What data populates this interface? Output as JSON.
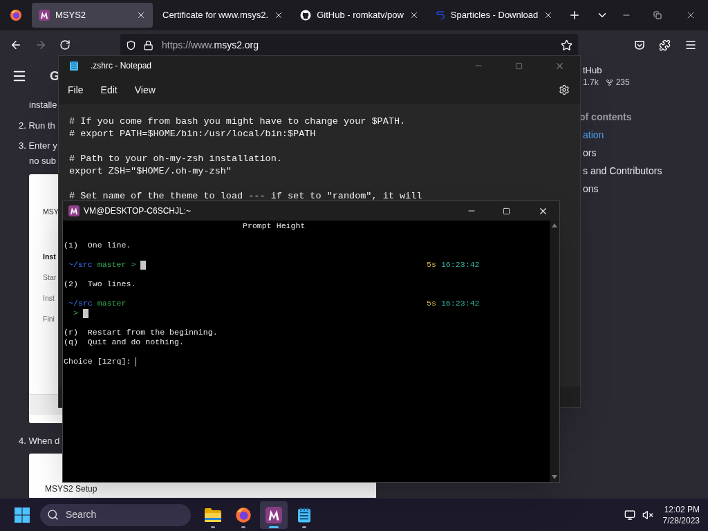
{
  "browser": {
    "tabs": [
      {
        "kind": "msys",
        "title": "MSYS2",
        "selected": true
      },
      {
        "kind": "plain",
        "title": "Certificate for www.msys2.",
        "selected": false
      },
      {
        "kind": "github",
        "title": "GitHub - romkatv/pow",
        "selected": false
      },
      {
        "kind": "sparticles",
        "title": "Sparticles - Download",
        "selected": false
      }
    ],
    "forward_disabled": true,
    "address": {
      "prefix": "https://www.",
      "domain": "msys2.org"
    }
  },
  "page": {
    "heading": "G",
    "left_lines": [
      {
        "kind": "continuation",
        "text": "installe"
      },
      {
        "kind": "step",
        "text": "2. Run th"
      },
      {
        "kind": "step",
        "text": "3. Enter y"
      },
      {
        "kind": "continuation",
        "text": "no sub"
      }
    ],
    "installer_card": {
      "title": "MSY",
      "section": "Inst",
      "steps": [
        "Star",
        "Inst",
        "Fini"
      ]
    },
    "after_card": {
      "kind": "step",
      "text": "4. When d"
    },
    "setup_card": {
      "title": "MSYS2 Setup"
    },
    "github": {
      "label": "tHub",
      "star_count": "1.7k",
      "fork_count": "235"
    },
    "toc": {
      "title": "of contents",
      "items": [
        {
          "text": "ation",
          "selected": true
        },
        {
          "text": "ors",
          "selected": false
        },
        {
          "text": "s and Contributors",
          "selected": false
        },
        {
          "text": "ons",
          "selected": false
        }
      ]
    }
  },
  "notepad": {
    "title": ".zshrc - Notepad",
    "menu": [
      "File",
      "Edit",
      "View"
    ],
    "paragraphs": [
      [
        "# If you come from bash you might have to change your $PATH.",
        "# export PATH=$HOME/bin:/usr/local/bin:$PATH"
      ],
      [
        "# Path to your oh-my-zsh installation.",
        "export ZSH=\"$HOME/.oh-my-zsh\""
      ],
      [
        "# Set name of the theme to load --- if set to \"random\", it will"
      ]
    ]
  },
  "terminal": {
    "title": "VM@DESKTOP-C6SCHJL:~",
    "lines": [
      {
        "kind": "heading",
        "text": "Prompt Height"
      },
      {
        "kind": "blank"
      },
      {
        "kind": "text",
        "text": "(1)  One line."
      },
      {
        "kind": "blank"
      },
      {
        "kind": "prompt_one_line",
        "dir": "~/src",
        "branch": "master",
        "symbol": ">",
        "duration": "5s",
        "time": "16:23:42"
      },
      {
        "kind": "blank"
      },
      {
        "kind": "text",
        "text": "(2)  Two lines."
      },
      {
        "kind": "blank"
      },
      {
        "kind": "prompt_two_line",
        "dir": "~/src",
        "branch": "master",
        "symbol": ">",
        "duration": "5s",
        "time": "16:23:42"
      },
      {
        "kind": "blank"
      },
      {
        "kind": "text",
        "text": "(r)  Restart from the beginning."
      },
      {
        "kind": "text",
        "text": "(q)  Quit and do nothing."
      },
      {
        "kind": "blank"
      },
      {
        "kind": "input",
        "text": "Choice [12rq]: "
      }
    ]
  },
  "taskbar": {
    "search_placeholder": "Search",
    "apps": [
      {
        "kind": "explorer",
        "selected": false
      },
      {
        "kind": "firefox",
        "selected": false
      },
      {
        "kind": "msys",
        "selected": true
      },
      {
        "kind": "notepad",
        "selected": false
      }
    ],
    "time": "12:02 PM",
    "date": "7/28/2023"
  }
}
